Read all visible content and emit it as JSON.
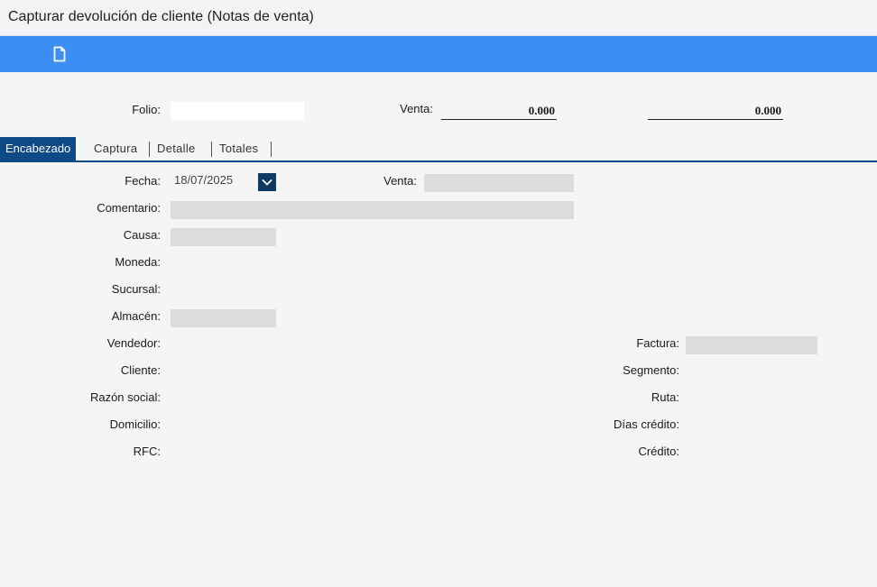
{
  "window": {
    "title": "Capturar devolución de cliente (Notas de venta)"
  },
  "toolbar": {
    "new_icon": "document-icon"
  },
  "header": {
    "folio_label": "Folio:",
    "folio_value": "",
    "venta_label": "Venta:",
    "venta_amount": "0.000",
    "second_amount": "0.000"
  },
  "tabs": [
    {
      "label": "Encabezado",
      "active": true
    },
    {
      "label": "Captura",
      "active": false
    },
    {
      "label": "Detalle",
      "active": false
    },
    {
      "label": "Totales",
      "active": false
    }
  ],
  "form": {
    "fecha_label": "Fecha:",
    "fecha_value": "18/07/2025",
    "venta_label": "Venta:",
    "comentario_label": "Comentario:",
    "causa_label": "Causa:",
    "moneda_label": "Moneda:",
    "sucursal_label": "Sucursal:",
    "almacen_label": "Almacén:",
    "vendedor_label": "Vendedor:",
    "cliente_label": "Cliente:",
    "razon_social_label": "Razón social:",
    "domicilio_label": "Domicilio:",
    "rfc_label": "RFC:",
    "factura_label": "Factura:",
    "segmento_label": "Segmento:",
    "ruta_label": "Ruta:",
    "dias_credito_label": "Días crédito:",
    "credito_label": "Crédito:"
  },
  "colors": {
    "toolbar": "#3c8ef2",
    "tab_active": "#0d4a86",
    "field_bg": "#dcdcdc"
  }
}
